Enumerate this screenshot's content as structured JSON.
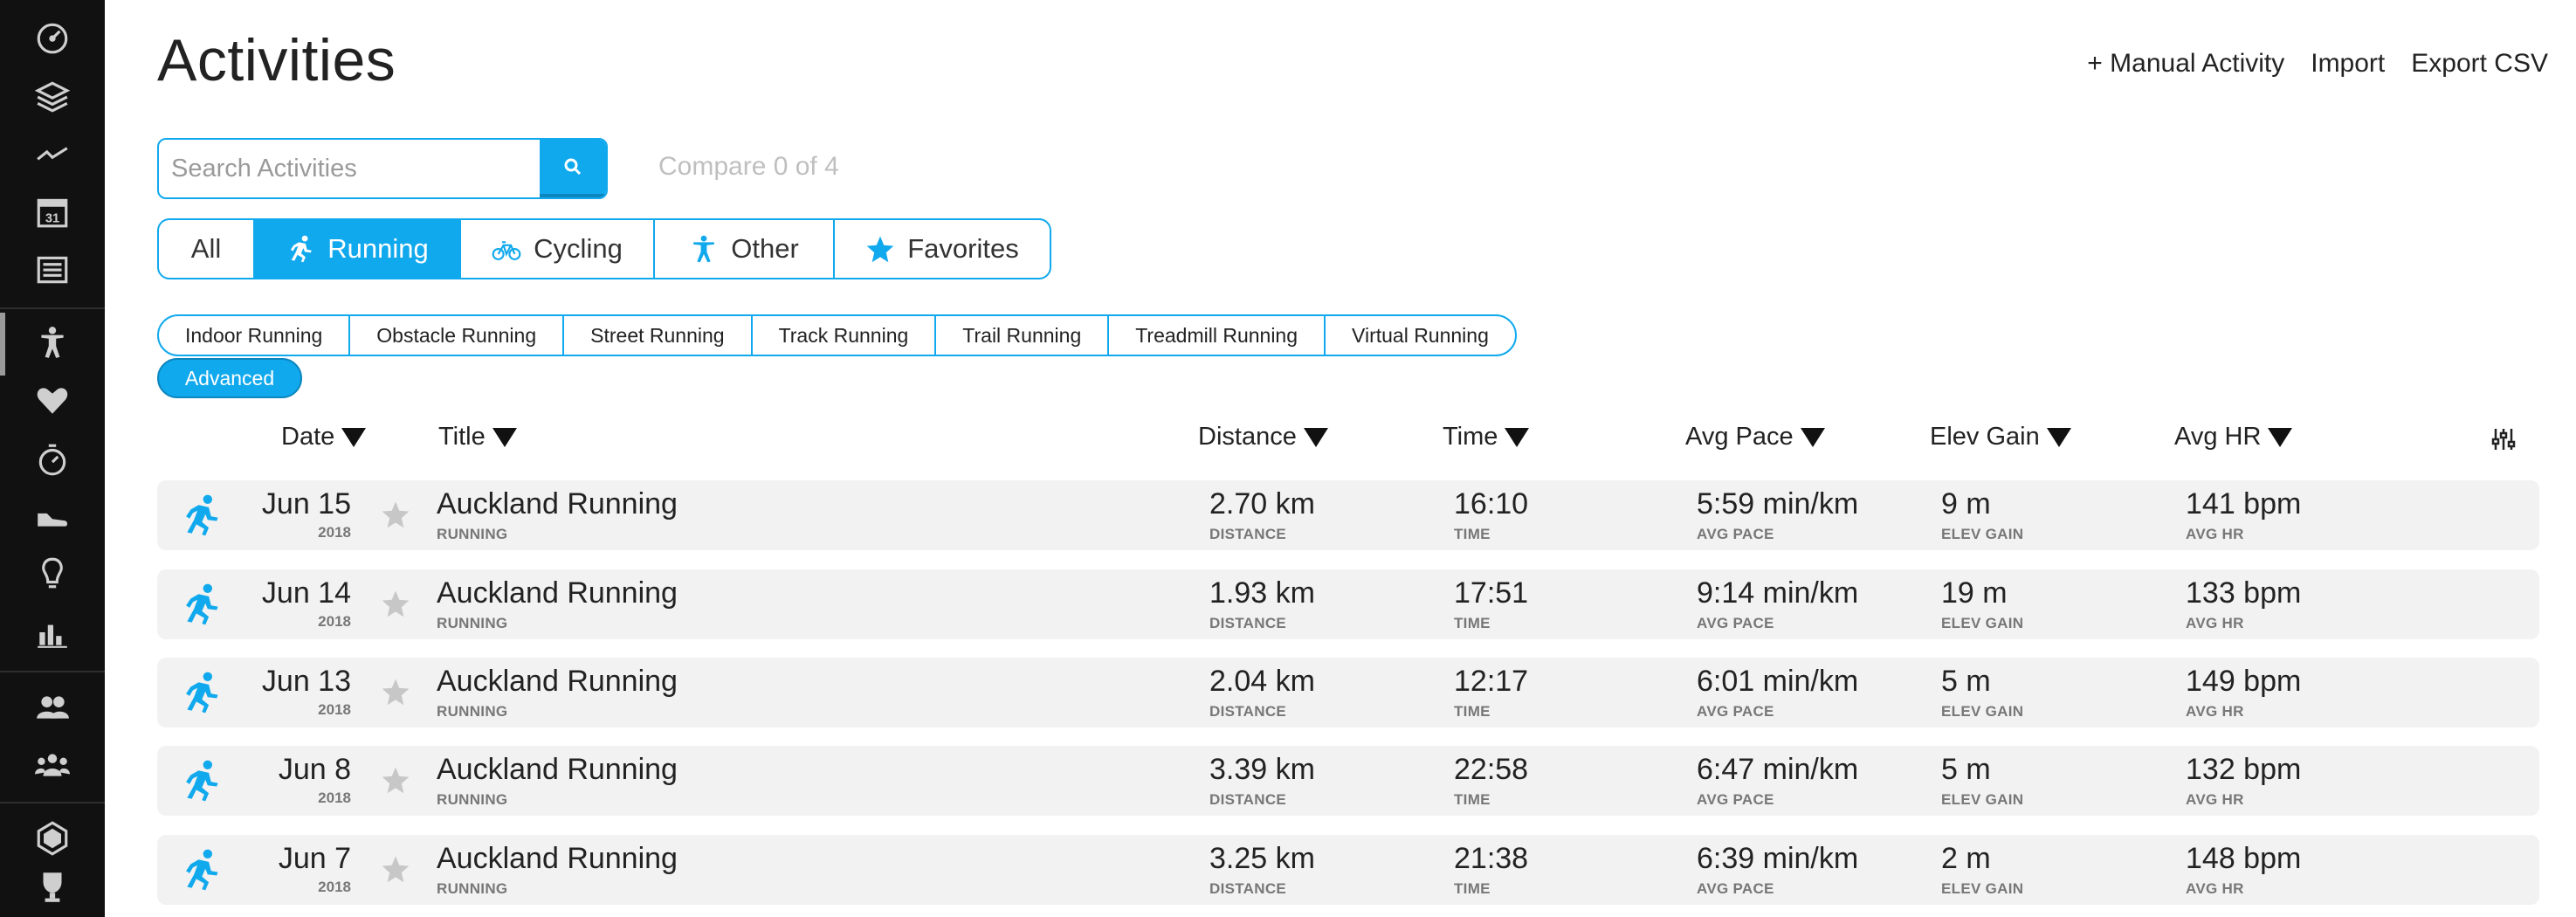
{
  "header": {
    "title": "Activities",
    "actions": [
      "+ Manual Activity",
      "Import",
      "Export CSV"
    ]
  },
  "search": {
    "placeholder": "Search Activities",
    "compare_text": "Compare 0 of 4"
  },
  "type_tabs": [
    {
      "label": "All",
      "icon": "",
      "active": false
    },
    {
      "label": "Running",
      "icon": "running-icon",
      "active": true
    },
    {
      "label": "Cycling",
      "icon": "cycling-icon",
      "active": false
    },
    {
      "label": "Other",
      "icon": "other-activity-icon",
      "active": false
    },
    {
      "label": "Favorites",
      "icon": "star-icon",
      "active": false
    }
  ],
  "sub_tabs": [
    "Indoor Running",
    "Obstacle Running",
    "Street Running",
    "Track Running",
    "Trail Running",
    "Treadmill Running",
    "Virtual Running"
  ],
  "advanced_label": "Advanced",
  "columns": {
    "date": "Date",
    "title": "Title",
    "distance": "Distance",
    "time": "Time",
    "avg_pace": "Avg Pace",
    "elev_gain": "Elev Gain",
    "avg_hr": "Avg HR"
  },
  "cell_labels": {
    "distance": "DISTANCE",
    "time": "TIME",
    "avg_pace": "AVG PACE",
    "elev_gain": "ELEV GAIN",
    "avg_hr": "AVG HR"
  },
  "rows": [
    {
      "date": "Jun 15",
      "year": "2018",
      "title": "Auckland Running",
      "type": "RUNNING",
      "distance": "2.70 km",
      "time": "16:10",
      "avg_pace": "5:59 min/km",
      "elev_gain": "9 m",
      "avg_hr": "141 bpm"
    },
    {
      "date": "Jun 14",
      "year": "2018",
      "title": "Auckland Running",
      "type": "RUNNING",
      "distance": "1.93 km",
      "time": "17:51",
      "avg_pace": "9:14 min/km",
      "elev_gain": "19 m",
      "avg_hr": "133 bpm"
    },
    {
      "date": "Jun 13",
      "year": "2018",
      "title": "Auckland Running",
      "type": "RUNNING",
      "distance": "2.04 km",
      "time": "12:17",
      "avg_pace": "6:01 min/km",
      "elev_gain": "5 m",
      "avg_hr": "149 bpm"
    },
    {
      "date": "Jun 8",
      "year": "2018",
      "title": "Auckland Running",
      "type": "RUNNING",
      "distance": "3.39 km",
      "time": "22:58",
      "avg_pace": "6:47 min/km",
      "elev_gain": "5 m",
      "avg_hr": "132 bpm"
    },
    {
      "date": "Jun 7",
      "year": "2018",
      "title": "Auckland Running",
      "type": "RUNNING",
      "distance": "3.25 km",
      "time": "21:38",
      "avg_pace": "6:39 min/km",
      "elev_gain": "2 m",
      "avg_hr": "148 bpm"
    }
  ],
  "sidebar": {
    "icons": [
      "dashboard-icon",
      "layers-icon",
      "activity-graph-icon",
      "calendar-icon",
      "news-icon",
      "activities-icon",
      "heart-icon",
      "stopwatch-icon",
      "shoe-icon",
      "lightbulb-icon",
      "bar-chart-icon",
      "connections-icon",
      "groups-icon",
      "badge-icon",
      "trophy-icon"
    ],
    "calendar_day": "31"
  },
  "colors": {
    "accent": "#11a9ed",
    "sidebar_bg": "#111111",
    "row_bg": "#f2f2f2"
  }
}
